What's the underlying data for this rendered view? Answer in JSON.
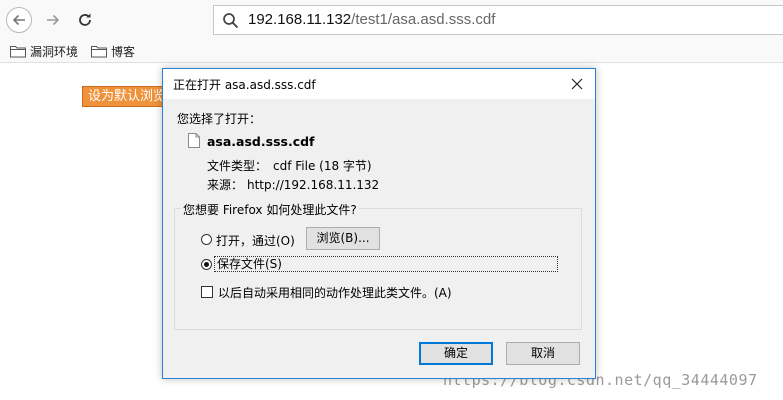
{
  "browser": {
    "url_host": "192.168.11.132",
    "url_path": "/test1/asa.asd.sss.cdf",
    "bookmarks": [
      {
        "label": "漏洞环境"
      },
      {
        "label": "博客"
      }
    ]
  },
  "page": {
    "button_label": "设为默认浏览",
    "watermark": "https://blog.csdn.net/qq_34444097"
  },
  "dialog": {
    "title": "正在打开 asa.asd.sss.cdf",
    "chose_label": "您选择了打开：",
    "file_name": "asa.asd.sss.cdf",
    "type_label": "文件类型：",
    "type_value": "cdf File (18 字节)",
    "source_label": "来源：",
    "source_value": "http://192.168.11.132",
    "question": "您想要 Firefox 如何处理此文件?",
    "open_with_label": "打开，通过(O)",
    "browse_label": "浏览(B)...",
    "save_label": "保存文件(S)",
    "auto_label": "以后自动采用相同的动作处理此类文件。(A)",
    "ok_label": "确定",
    "cancel_label": "取消",
    "selected_option": "save"
  },
  "icons": {
    "back": "back-arrow-icon",
    "forward": "forward-arrow-icon",
    "reload": "reload-icon",
    "search": "search-icon",
    "folder": "folder-icon",
    "file": "file-icon",
    "close": "close-icon"
  },
  "colors": {
    "page_button_bg": "#f0923a",
    "dialog_border": "#2a7fd6",
    "default_button_border": "#0078d7"
  }
}
